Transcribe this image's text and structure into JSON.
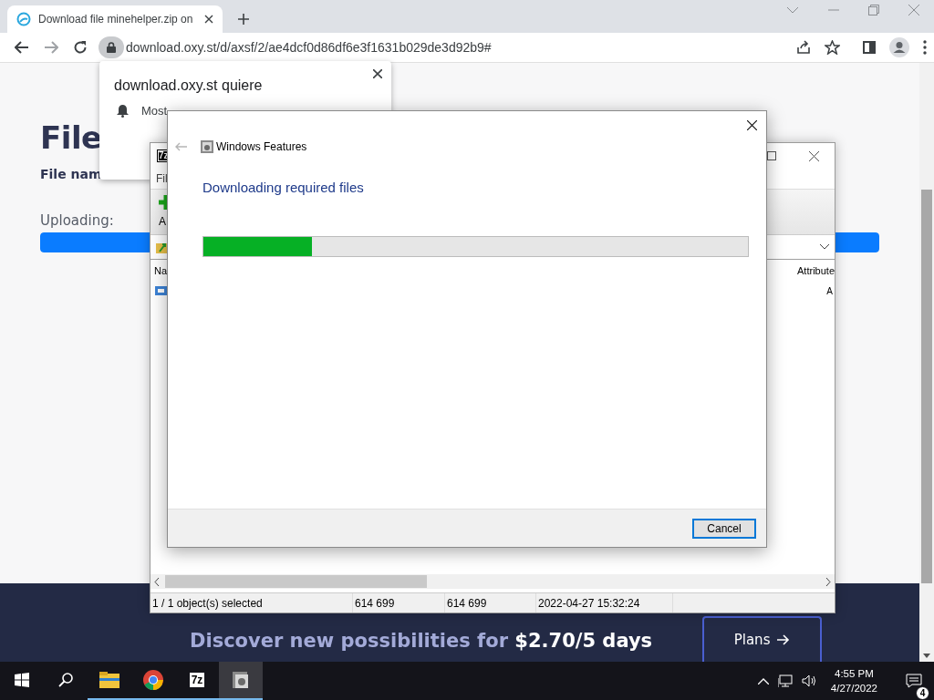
{
  "browser": {
    "tab": {
      "title": "Download file minehelper.zip on",
      "selected": true
    },
    "url": "download.oxy.st/d/axsf/2/ae4dcf0d86df6e3f1631b029de3d92b9#"
  },
  "page": {
    "heading": "File",
    "file_name_label": "File nam",
    "uploading_label": "Uploading:",
    "upload_progress": {
      "level": 1
    },
    "banner": {
      "text": "Discover new possibilities for **$2.70/5 days**",
      "button": "Plans"
    }
  },
  "notification_prompt": {
    "title": "download.oxy.st quiere",
    "permission": "Most"
  },
  "archive_window": {
    "icon_text": "7z",
    "menu": [
      "Fil"
    ],
    "toolbar": [
      "A"
    ],
    "columns": [
      "Na",
      "Attribute"
    ],
    "rows": [
      {
        "column_2": "A"
      }
    ],
    "status_bar": [
      "1 / 1 object(s) selected",
      "614 699",
      "614 699",
      "2022-04-27 15:32:24"
    ]
  },
  "dialog": {
    "title": "Windows Features",
    "heading": "Downloading required files",
    "progress": {
      "level": 0.2
    },
    "buttons": [
      "Cancel"
    ]
  },
  "taskbar": {
    "apps": [
      {
        "kind": "folder",
        "running": true,
        "selected": false
      },
      {
        "kind": "browser",
        "running": true,
        "selected": false
      },
      {
        "kind": "archiver",
        "label": "7z",
        "running": true,
        "selected": false
      },
      {
        "kind": "installer",
        "running": true,
        "selected": true
      }
    ],
    "clock": {
      "time": "4:55 PM",
      "date": "4/27/2022"
    },
    "notifications": "4"
  }
}
